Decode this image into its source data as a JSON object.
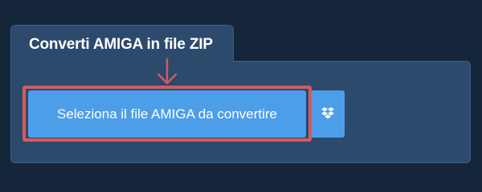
{
  "converter": {
    "title": "Converti AMIGA in file ZIP",
    "select_button_label": "Seleziona il file AMIGA da convertire",
    "dropbox_icon": "dropbox-icon"
  },
  "colors": {
    "background": "#15253a",
    "panel": "#2c4a6c",
    "button": "#4d9ee9",
    "highlight": "#d65a5e"
  }
}
